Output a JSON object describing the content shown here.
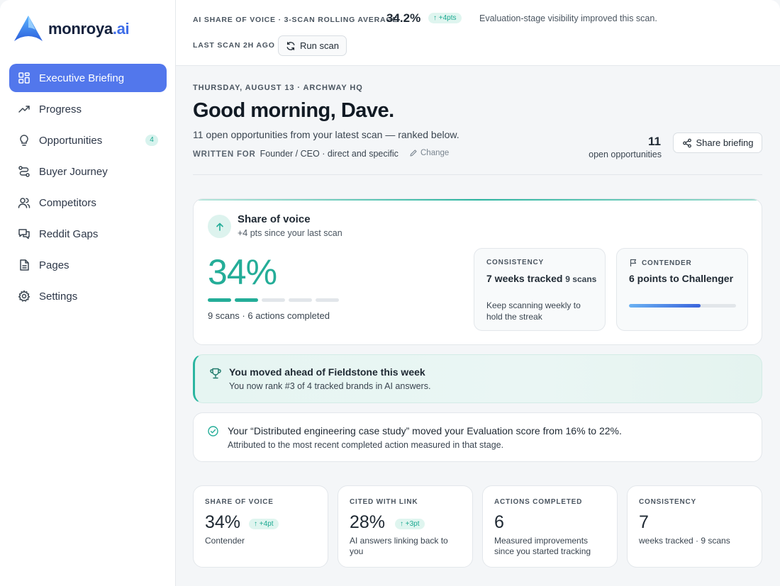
{
  "brand": {
    "name_main": "monroya",
    "name_suffix": ".ai"
  },
  "sidebar": {
    "items": [
      {
        "label": "Executive Briefing",
        "icon": "grid-icon",
        "active": true
      },
      {
        "label": "Progress",
        "icon": "trend-up-icon"
      },
      {
        "label": "Opportunities",
        "icon": "lightbulb-icon",
        "badge": "4"
      },
      {
        "label": "Buyer Journey",
        "icon": "route-icon"
      },
      {
        "label": "Competitors",
        "icon": "users-icon"
      },
      {
        "label": "Reddit Gaps",
        "icon": "chat-icon"
      },
      {
        "label": "Pages",
        "icon": "page-icon"
      },
      {
        "label": "Settings",
        "icon": "gear-icon"
      }
    ]
  },
  "topbar": {
    "sov_label": "AI SHARE OF VOICE · 3-SCAN ROLLING AVERAGE",
    "sov_value": "34.2%",
    "sov_delta": "+4pts",
    "note": "Evaluation-stage visibility improved this scan.",
    "last_scan": "LAST SCAN 2H AGO",
    "run_scan": "Run scan"
  },
  "header": {
    "date_line": "THURSDAY, AUGUST 13 · ARCHWAY HQ",
    "greeting": "Good morning, Dave.",
    "subtitle": "11 open opportunities from your latest scan — ranked below.",
    "written_for_label": "WRITTEN FOR",
    "written_for_value": "Founder / CEO · direct and specific",
    "change": "Change",
    "open_count": "11",
    "open_label": "open opportunities",
    "share_button": "Share briefing"
  },
  "sov_card": {
    "title": "Share of voice",
    "subtitle": "+4 pts since your last scan",
    "value": "34%",
    "segments_on": 2,
    "segments_total": 5,
    "meta": "9 scans · 6 actions completed",
    "consistency": {
      "label": "CONSISTENCY",
      "title": "7 weeks tracked",
      "title_small": "9 scans",
      "note": "Keep scanning weekly to hold the streak"
    },
    "contender": {
      "label": "CONTENDER",
      "title": "6 points to Challenger",
      "progress": 0.67
    }
  },
  "moved": {
    "title": "You moved ahead of Fieldstone this week",
    "subtitle": "You now rank #3 of 4 tracked brands in AI answers."
  },
  "attribution": {
    "title": "Your “Distributed engineering case study” moved your Evaluation score from 16% to 22%.",
    "subtitle": "Attributed to the most recent completed action measured in that stage."
  },
  "stats": [
    {
      "label": "SHARE OF VOICE",
      "value": "34%",
      "delta": "+4pt",
      "desc": "Contender"
    },
    {
      "label": "CITED WITH LINK",
      "value": "28%",
      "delta": "+3pt",
      "desc": "AI answers linking back to you"
    },
    {
      "label": "ACTIONS COMPLETED",
      "value": "6",
      "desc": "Measured improvements since you started tracking"
    },
    {
      "label": "CONSISTENCY",
      "value": "7",
      "desc": "weeks tracked · 9 scans"
    }
  ],
  "colors": {
    "accent": "#5277ec",
    "teal": "#24ad98",
    "brand_dark": "#14213d"
  }
}
